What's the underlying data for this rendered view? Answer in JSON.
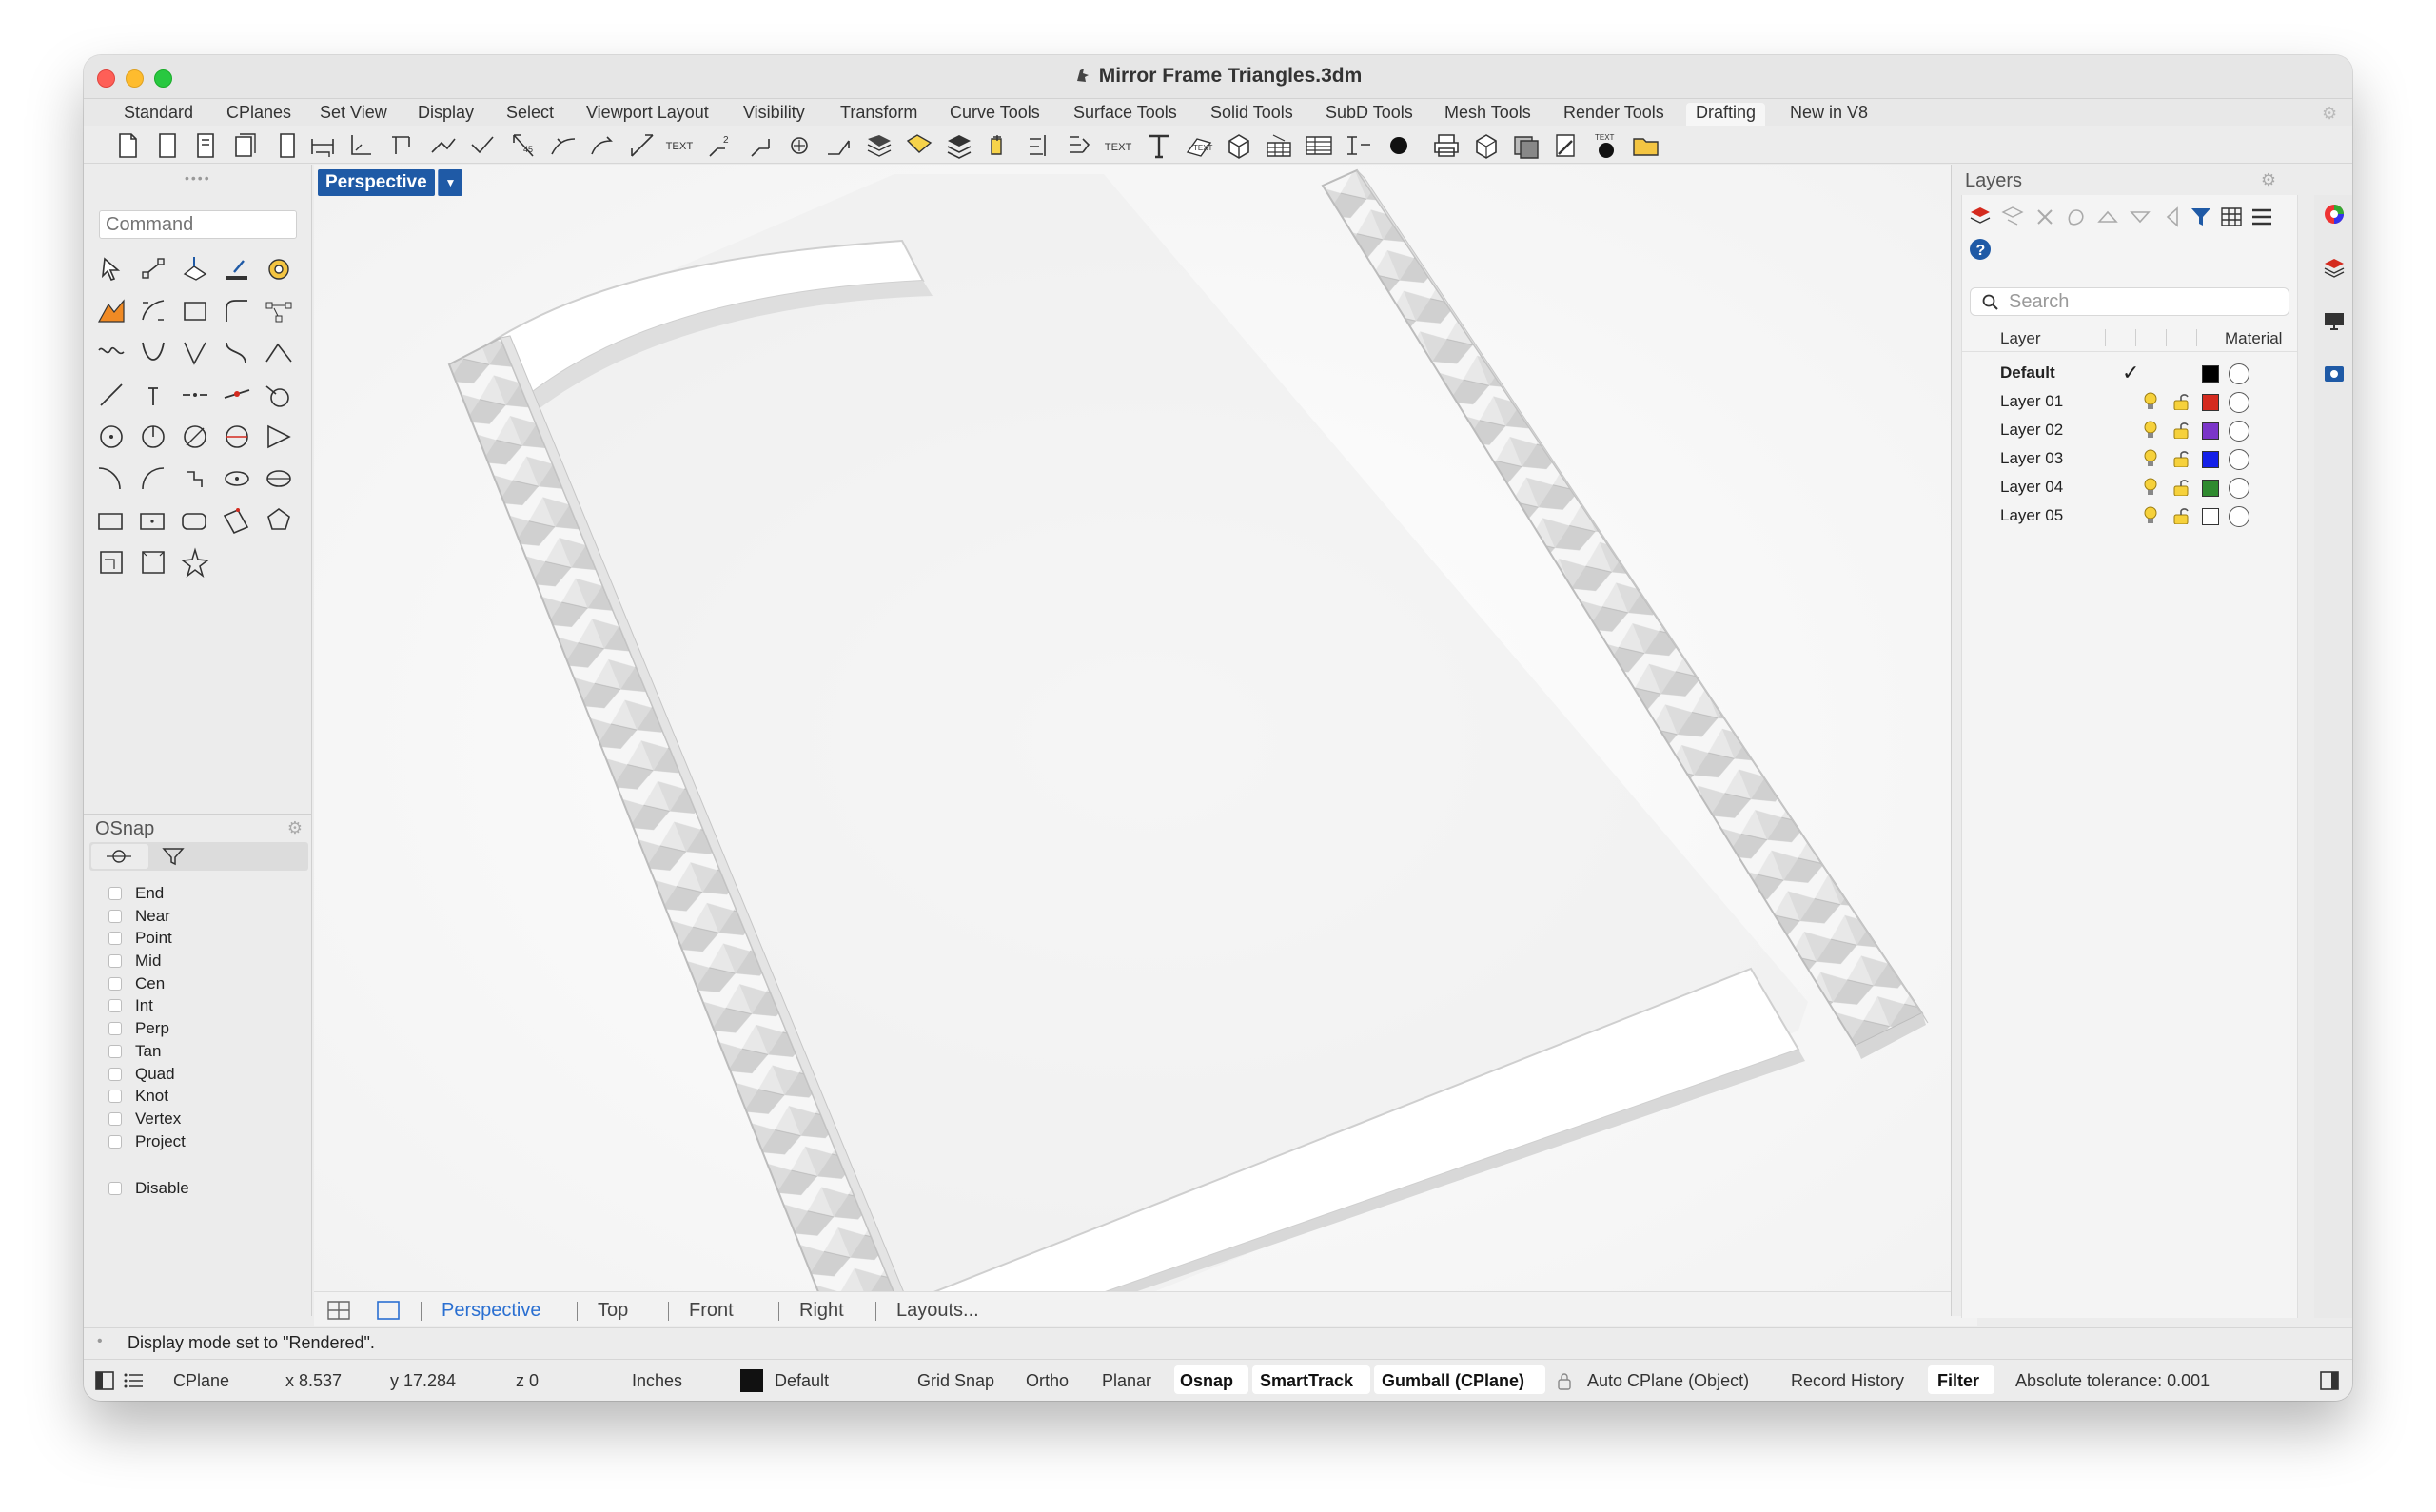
{
  "window": {
    "title": "Mirror Frame Triangles.3dm"
  },
  "toolbar_tabs": [
    {
      "label": "Standard",
      "active": false
    },
    {
      "label": "CPlanes",
      "active": false
    },
    {
      "label": "Set View",
      "active": false
    },
    {
      "label": "Display",
      "active": false
    },
    {
      "label": "Select",
      "active": false
    },
    {
      "label": "Viewport Layout",
      "active": false
    },
    {
      "label": "Visibility",
      "active": false
    },
    {
      "label": "Transform",
      "active": false
    },
    {
      "label": "Curve Tools",
      "active": false
    },
    {
      "label": "Surface Tools",
      "active": false
    },
    {
      "label": "Solid Tools",
      "active": false
    },
    {
      "label": "SubD Tools",
      "active": false
    },
    {
      "label": "Mesh Tools",
      "active": false
    },
    {
      "label": "Render Tools",
      "active": false
    },
    {
      "label": "Drafting",
      "active": true
    },
    {
      "label": "New in V8",
      "active": false
    }
  ],
  "command": {
    "placeholder": "Command"
  },
  "osnap": {
    "title": "OSnap",
    "items": [
      "End",
      "Near",
      "Point",
      "Mid",
      "Cen",
      "Int",
      "Perp",
      "Tan",
      "Quad",
      "Knot",
      "Vertex",
      "Project"
    ],
    "disable_label": "Disable"
  },
  "viewport": {
    "label": "Perspective",
    "tabs": [
      "Perspective",
      "Top",
      "Front",
      "Right",
      "Layouts..."
    ],
    "active_tab": "Perspective"
  },
  "layers": {
    "title": "Layers",
    "search_placeholder": "Search",
    "col_layer": "Layer",
    "col_material": "Material",
    "rows": [
      {
        "name": "Default",
        "color": "#000000",
        "current": true
      },
      {
        "name": "Layer 01",
        "color": "#d42a1e",
        "current": false
      },
      {
        "name": "Layer 02",
        "color": "#7b35c9",
        "current": false
      },
      {
        "name": "Layer 03",
        "color": "#1420e8",
        "current": false
      },
      {
        "name": "Layer 04",
        "color": "#2f8a2f",
        "current": false
      },
      {
        "name": "Layer 05",
        "color": "#ffffff",
        "current": false
      }
    ]
  },
  "command_line": {
    "text": "Display mode set to \"Rendered\"."
  },
  "status_bar": {
    "cplane": "CPlane",
    "x": "x 8.537",
    "y": "y 17.284",
    "z": "z 0",
    "units": "Inches",
    "layer": "Default",
    "grid_snap": "Grid Snap",
    "ortho": "Ortho",
    "planar": "Planar",
    "osnap": "Osnap",
    "smarttrack": "SmartTrack",
    "gumball": "Gumball (CPlane)",
    "auto_cplane": "Auto CPlane (Object)",
    "record_history": "Record History",
    "filter": "Filter",
    "tolerance": "Absolute tolerance: 0.001"
  }
}
